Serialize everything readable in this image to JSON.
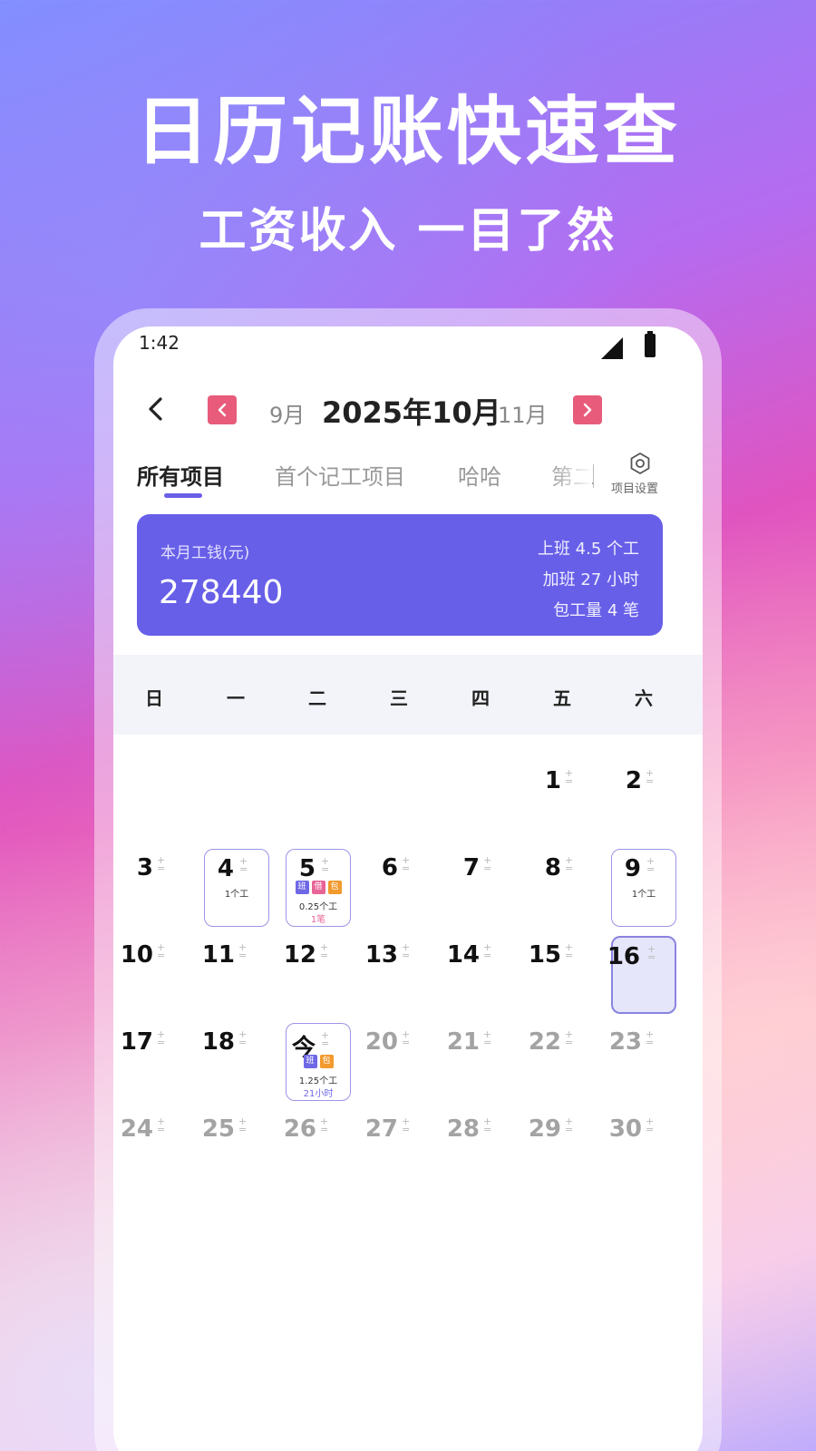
{
  "promo": {
    "headline": "日历记账快速查",
    "subline": "工资收入 一目了然"
  },
  "status_bar": {
    "time": "1:42"
  },
  "month_nav": {
    "prev_label": "9月",
    "current": "2025年10月",
    "next_label": "11月"
  },
  "tabs": [
    {
      "label": "所有项目",
      "active": true
    },
    {
      "label": "首个记工项目",
      "active": false
    },
    {
      "label": "哈哈",
      "active": false
    },
    {
      "label": "第二",
      "active": false
    }
  ],
  "settings_label": "项目设置",
  "summary": {
    "label": "本月工钱(元)",
    "amount": "278440",
    "stat_work": "上班 4.5 个工",
    "stat_overtime": "加班 27 小时",
    "stat_contract": "包工量 4 笔"
  },
  "weekdays": [
    "日",
    "一",
    "二",
    "三",
    "四",
    "五",
    "六"
  ],
  "calendar": {
    "days": [
      {
        "label": "1",
        "col": 5,
        "row": 0
      },
      {
        "label": "2",
        "col": 6,
        "row": 0
      },
      {
        "label": "3",
        "col": 0,
        "row": 1
      },
      {
        "label": "4",
        "col": 1,
        "row": 1,
        "boxed": true,
        "notes": [
          {
            "text": "1个工",
            "style": "dark"
          }
        ]
      },
      {
        "label": "5",
        "col": 2,
        "row": 1,
        "boxed": true,
        "tags": [
          {
            "text": "班",
            "color": "purple"
          },
          {
            "text": "借",
            "color": "pink"
          },
          {
            "text": "包",
            "color": "orange"
          }
        ],
        "notes": [
          {
            "text": "0.25个工",
            "style": "dark"
          },
          {
            "text": "1笔",
            "style": "pink"
          }
        ]
      },
      {
        "label": "6",
        "col": 3,
        "row": 1
      },
      {
        "label": "7",
        "col": 4,
        "row": 1
      },
      {
        "label": "8",
        "col": 5,
        "row": 1
      },
      {
        "label": "9",
        "col": 6,
        "row": 1,
        "boxed": true,
        "notes": [
          {
            "text": "1个工",
            "style": "dark"
          }
        ]
      },
      {
        "label": "10",
        "col": 0,
        "row": 2
      },
      {
        "label": "11",
        "col": 1,
        "row": 2
      },
      {
        "label": "12",
        "col": 2,
        "row": 2
      },
      {
        "label": "13",
        "col": 3,
        "row": 2
      },
      {
        "label": "14",
        "col": 4,
        "row": 2
      },
      {
        "label": "15",
        "col": 5,
        "row": 2
      },
      {
        "label": "16",
        "col": 6,
        "row": 2,
        "selected": true
      },
      {
        "label": "17",
        "col": 0,
        "row": 3
      },
      {
        "label": "18",
        "col": 1,
        "row": 3
      },
      {
        "label": "今",
        "col": 2,
        "row": 3,
        "boxed": true,
        "today": true,
        "tags": [
          {
            "text": "班",
            "color": "purple"
          },
          {
            "text": "包",
            "color": "orange"
          }
        ],
        "notes": [
          {
            "text": "1.25个工",
            "style": "dark"
          },
          {
            "text": "21小时",
            "style": "purple"
          }
        ]
      },
      {
        "label": "20",
        "col": 3,
        "row": 3,
        "future": true
      },
      {
        "label": "21",
        "col": 4,
        "row": 3,
        "future": true
      },
      {
        "label": "22",
        "col": 5,
        "row": 3,
        "future": true
      },
      {
        "label": "23",
        "col": 6,
        "row": 3,
        "future": true
      },
      {
        "label": "24",
        "col": 0,
        "row": 4,
        "future": true
      },
      {
        "label": "25",
        "col": 1,
        "row": 4,
        "future": true
      },
      {
        "label": "26",
        "col": 2,
        "row": 4,
        "future": true
      },
      {
        "label": "27",
        "col": 3,
        "row": 4,
        "future": true
      },
      {
        "label": "28",
        "col": 4,
        "row": 4,
        "future": true
      },
      {
        "label": "29",
        "col": 5,
        "row": 4,
        "future": true
      },
      {
        "label": "30",
        "col": 6,
        "row": 4,
        "future": true
      }
    ]
  },
  "colors": {
    "accent": "#675fe8",
    "nav_arrow": "#e85b7a",
    "tag_purple": "#6f68e6",
    "tag_pink": "#e86496",
    "tag_orange": "#f29a2e"
  }
}
